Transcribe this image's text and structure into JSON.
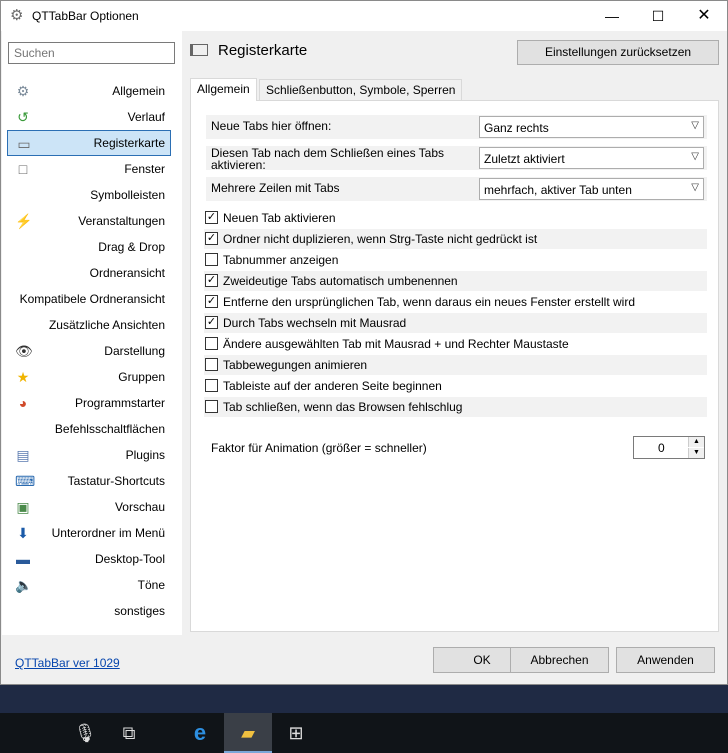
{
  "window": {
    "title": "QTTabBar Optionen",
    "minimize": "—",
    "maximize": "☐",
    "close": "✕"
  },
  "search": {
    "placeholder": "Suchen"
  },
  "sidebar": {
    "items": [
      {
        "label": "Allgemein",
        "icon": "gear-icon",
        "glyph": "⚙",
        "color": "#7a8a99"
      },
      {
        "label": "Verlauf",
        "icon": "history-icon",
        "glyph": "↺",
        "color": "#3a9a3a"
      },
      {
        "label": "Registerkarte",
        "icon": "tab-icon",
        "glyph": "▭",
        "color": "#666"
      },
      {
        "label": "Fenster",
        "icon": "window-icon",
        "glyph": "□",
        "color": "#666"
      },
      {
        "label": "Symbolleisten",
        "icon": "",
        "glyph": "",
        "color": ""
      },
      {
        "label": "Veranstaltungen",
        "icon": "lightning-icon",
        "glyph": "⚡",
        "color": "#e0b000"
      },
      {
        "label": "Drag & Drop",
        "icon": "",
        "glyph": "",
        "color": ""
      },
      {
        "label": "Ordneransicht",
        "icon": "",
        "glyph": "",
        "color": ""
      },
      {
        "label": "Kompatibele Ordneransicht",
        "icon": "",
        "glyph": "",
        "color": ""
      },
      {
        "label": "Zusätzliche Ansichten",
        "icon": "",
        "glyph": "",
        "color": ""
      },
      {
        "label": "Darstellung",
        "icon": "eye-icon",
        "glyph": "👁",
        "color": "#333"
      },
      {
        "label": "Gruppen",
        "icon": "star-icon",
        "glyph": "★",
        "color": "#f0b400"
      },
      {
        "label": "Programmstarter",
        "icon": "launcher-icon",
        "glyph": "◕",
        "color": "#d04a2a"
      },
      {
        "label": "Befehlsschaltflächen",
        "icon": "",
        "glyph": "",
        "color": ""
      },
      {
        "label": "Plugins",
        "icon": "plugin-icon",
        "glyph": "▤",
        "color": "#5a7ab0"
      },
      {
        "label": "Tastatur-Shortcuts",
        "icon": "keyboard-icon",
        "glyph": "⌨",
        "color": "#2a6ab0"
      },
      {
        "label": "Vorschau",
        "icon": "preview-icon",
        "glyph": "▣",
        "color": "#4a8a4a"
      },
      {
        "label": "Unterordner im Menü",
        "icon": "download-icon",
        "glyph": "⬇",
        "color": "#1a5aa8"
      },
      {
        "label": "Desktop-Tool",
        "icon": "desktop-icon",
        "glyph": "▬",
        "color": "#2a5a9a"
      },
      {
        "label": "Töne",
        "icon": "speaker-icon",
        "glyph": "🔈",
        "color": "#777"
      },
      {
        "label": "sonstiges",
        "icon": "",
        "glyph": "",
        "color": ""
      }
    ],
    "selected_index": 2
  },
  "footer_link": "QTTabBar ver 1029",
  "main": {
    "title": "Registerkarte",
    "reset_button": "Einstellungen zurücksetzen",
    "tabs": [
      {
        "label": "Allgemein",
        "active": true
      },
      {
        "label": "Schließenbutton, Symbole, Sperren",
        "active": false
      }
    ],
    "dropdowns": [
      {
        "label": "Neue Tabs hier öffnen:",
        "value": "Ganz rechts"
      },
      {
        "label": "Diesen Tab nach dem Schließen eines Tabs aktivieren:",
        "value": "Zuletzt aktiviert"
      },
      {
        "label": "Mehrere Zeilen mit Tabs",
        "value": "mehrfach, aktiver Tab unten"
      }
    ],
    "checkboxes": [
      {
        "label": "Neuen Tab aktivieren",
        "checked": true
      },
      {
        "label": "Ordner nicht duplizieren, wenn Strg-Taste nicht gedrückt ist",
        "checked": true
      },
      {
        "label": "Tabnummer anzeigen",
        "checked": false
      },
      {
        "label": "Zweideutige Tabs automatisch umbenennen",
        "checked": true
      },
      {
        "label": "Entferne den ursprünglichen Tab, wenn daraus ein neues Fenster erstellt wird",
        "checked": true
      },
      {
        "label": "Durch Tabs wechseln mit Mausrad",
        "checked": true
      },
      {
        "label": "Ändere ausgewählten Tab mit Mausrad + und Rechter Maustaste",
        "checked": false
      },
      {
        "label": "Tabbewegungen animieren",
        "checked": false
      },
      {
        "label": "Tableiste auf der anderen Seite beginnen",
        "checked": false
      },
      {
        "label": "Tab schließen, wenn das Browsen fehlschlug",
        "checked": false
      }
    ],
    "animation": {
      "label": "Faktor für Animation (größer = schneller)",
      "value": "0"
    }
  },
  "buttons": {
    "ok": "OK",
    "cancel": "Abbrechen",
    "apply": "Anwenden"
  },
  "taskbar": {
    "items": [
      {
        "name": "microphone-icon",
        "glyph": "🎙"
      },
      {
        "name": "task-view-icon",
        "glyph": "⧉"
      },
      {
        "name": "edge-icon",
        "glyph": "e"
      },
      {
        "name": "file-explorer-icon",
        "glyph": "▰"
      },
      {
        "name": "store-icon",
        "glyph": "⊞"
      }
    ],
    "active_index": 3
  }
}
